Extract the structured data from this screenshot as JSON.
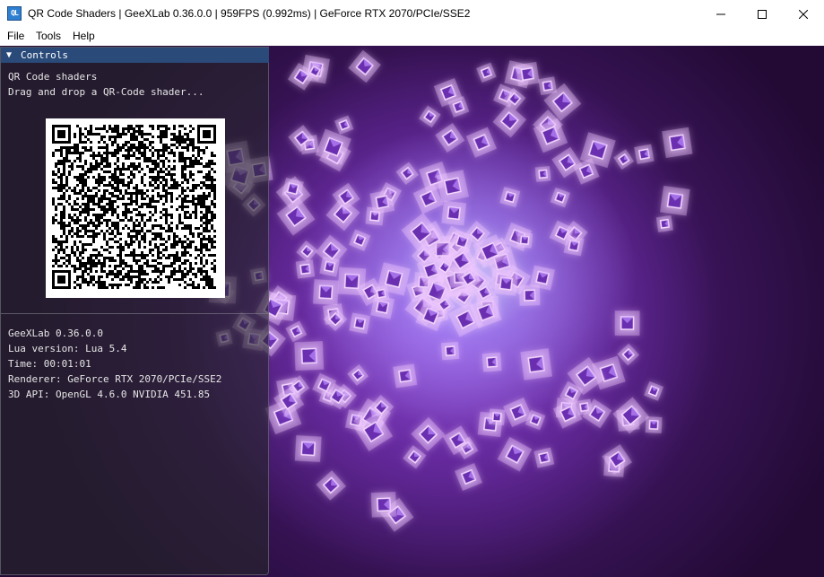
{
  "window": {
    "title": "QR Code Shaders | GeeXLab 0.36.0.0 | 959FPS (0.992ms) | GeForce RTX 2070/PCIe/SSE2",
    "app_icon_text": "QL",
    "minimize_icon": "minimize-icon",
    "maximize_icon": "maximize-icon",
    "close_icon": "close-icon"
  },
  "menubar": {
    "items": [
      "File",
      "Tools",
      "Help"
    ]
  },
  "controls": {
    "header_arrow": "▼",
    "header_label": "Controls",
    "lines": [
      "QR Code shaders",
      "Drag and drop a QR-Code shader..."
    ],
    "qr_icon": "qr-code-image",
    "info": [
      "GeeXLab 0.36.0.0",
      "Lua version: Lua 5.4",
      "Time: 00:01:01",
      "Renderer: GeForce RTX 2070/PCIe/SSE2",
      "3D API: OpenGL 4.6.0 NVIDIA 451.85"
    ]
  },
  "colors": {
    "panel_header": "#2a4a7a",
    "glow_center": "#cdd7ff",
    "glow_purple": "#a05aeb",
    "background_dark": "#230a35",
    "cube": "#6b2fb0"
  }
}
